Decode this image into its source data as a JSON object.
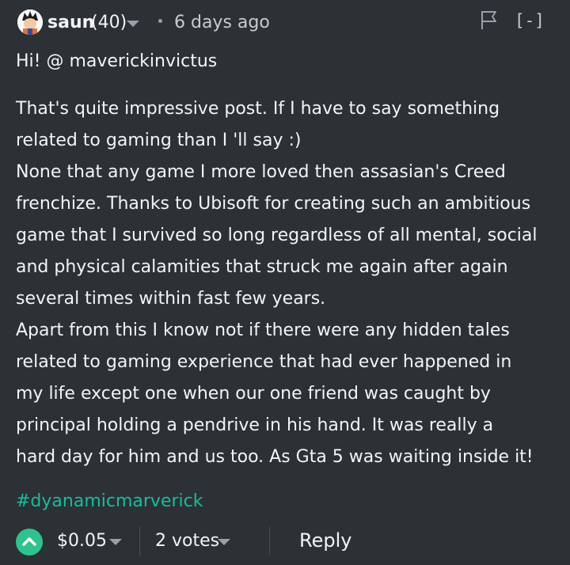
{
  "comment": {
    "author": "saun",
    "reputation": "(40)",
    "time": "6 days ago",
    "collapse_label": "[-]",
    "greeting": "Hi! @ maverickinvictus",
    "body_lines": [
      "That's quite impressive post. If I have to say something",
      "related to gaming than I 'll say :)",
      "None that any game I more loved then assasian's Creed",
      "frenchize. Thanks to Ubisoft for creating such an ambitious",
      "game that I survived so long regardless of all mental, social",
      "and physical calamities that struck me again after again",
      "several times within fast few years.",
      "Apart from this I know not if there were any hidden tales",
      "related to gaming experience that had ever happened in",
      "my life except one when our one friend was caught by",
      "principal holding a pendrive in his hand. It was really a",
      "hard day for him and us too. As Gta 5 was waiting inside it!"
    ],
    "hashtag": "#dyanamicmarverick"
  },
  "footer": {
    "payout": "$0.05",
    "votes": "2 votes",
    "reply_label": "Reply"
  },
  "colors": {
    "background": "#2c3136",
    "text": "#f4f4f5",
    "secondary_text": "#c8ccd0",
    "hashtag": "#1abc9c",
    "upvote": "#2fc28f"
  },
  "icons": {
    "avatar": "avatar",
    "author_menu": "chevron-down-icon",
    "flag": "flag-icon",
    "upvote": "upvote-chevron-icon",
    "payout_menu": "chevron-down-icon",
    "votes_menu": "chevron-down-icon"
  }
}
